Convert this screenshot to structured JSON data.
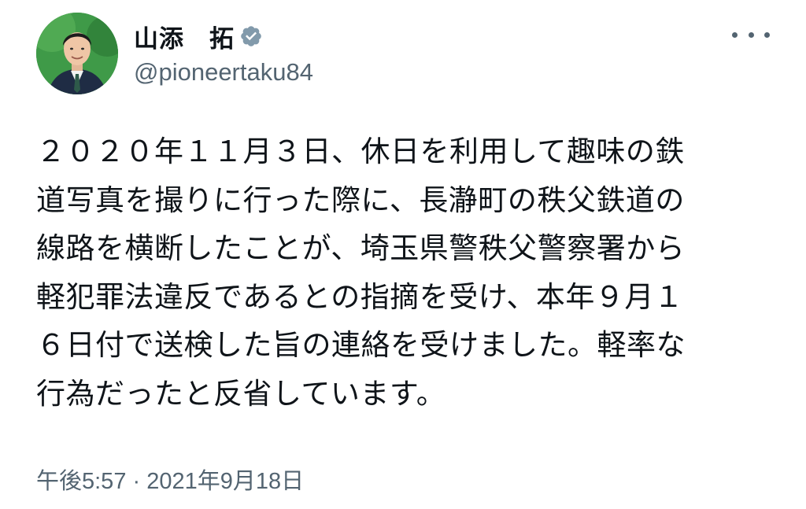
{
  "author": {
    "display_name": "山添　拓",
    "handle": "@pioneertaku84",
    "verified": true
  },
  "icons": {
    "verified": "verified-badge-icon",
    "more": "more-options-icon"
  },
  "colors": {
    "text": "#0f1419",
    "secondary": "#536471",
    "verified_badge": "#829aab",
    "avatar_bg": "#2f8a3c"
  },
  "tweet": {
    "text": "２０２０年１１月３日、休日を利用して趣味の鉄\n道写真を撮りに行った際に、長瀞町の秩父鉄道の\n線路を横断したことが、埼玉県警秩父警察署から\n軽犯罪法違反であるとの指摘を受け、本年９月１\n６日付で送検した旨の連絡を受けました。軽率な\n行為だったと反省しています。",
    "time": "午後5:57",
    "separator": "·",
    "date": "2021年9月18日"
  }
}
